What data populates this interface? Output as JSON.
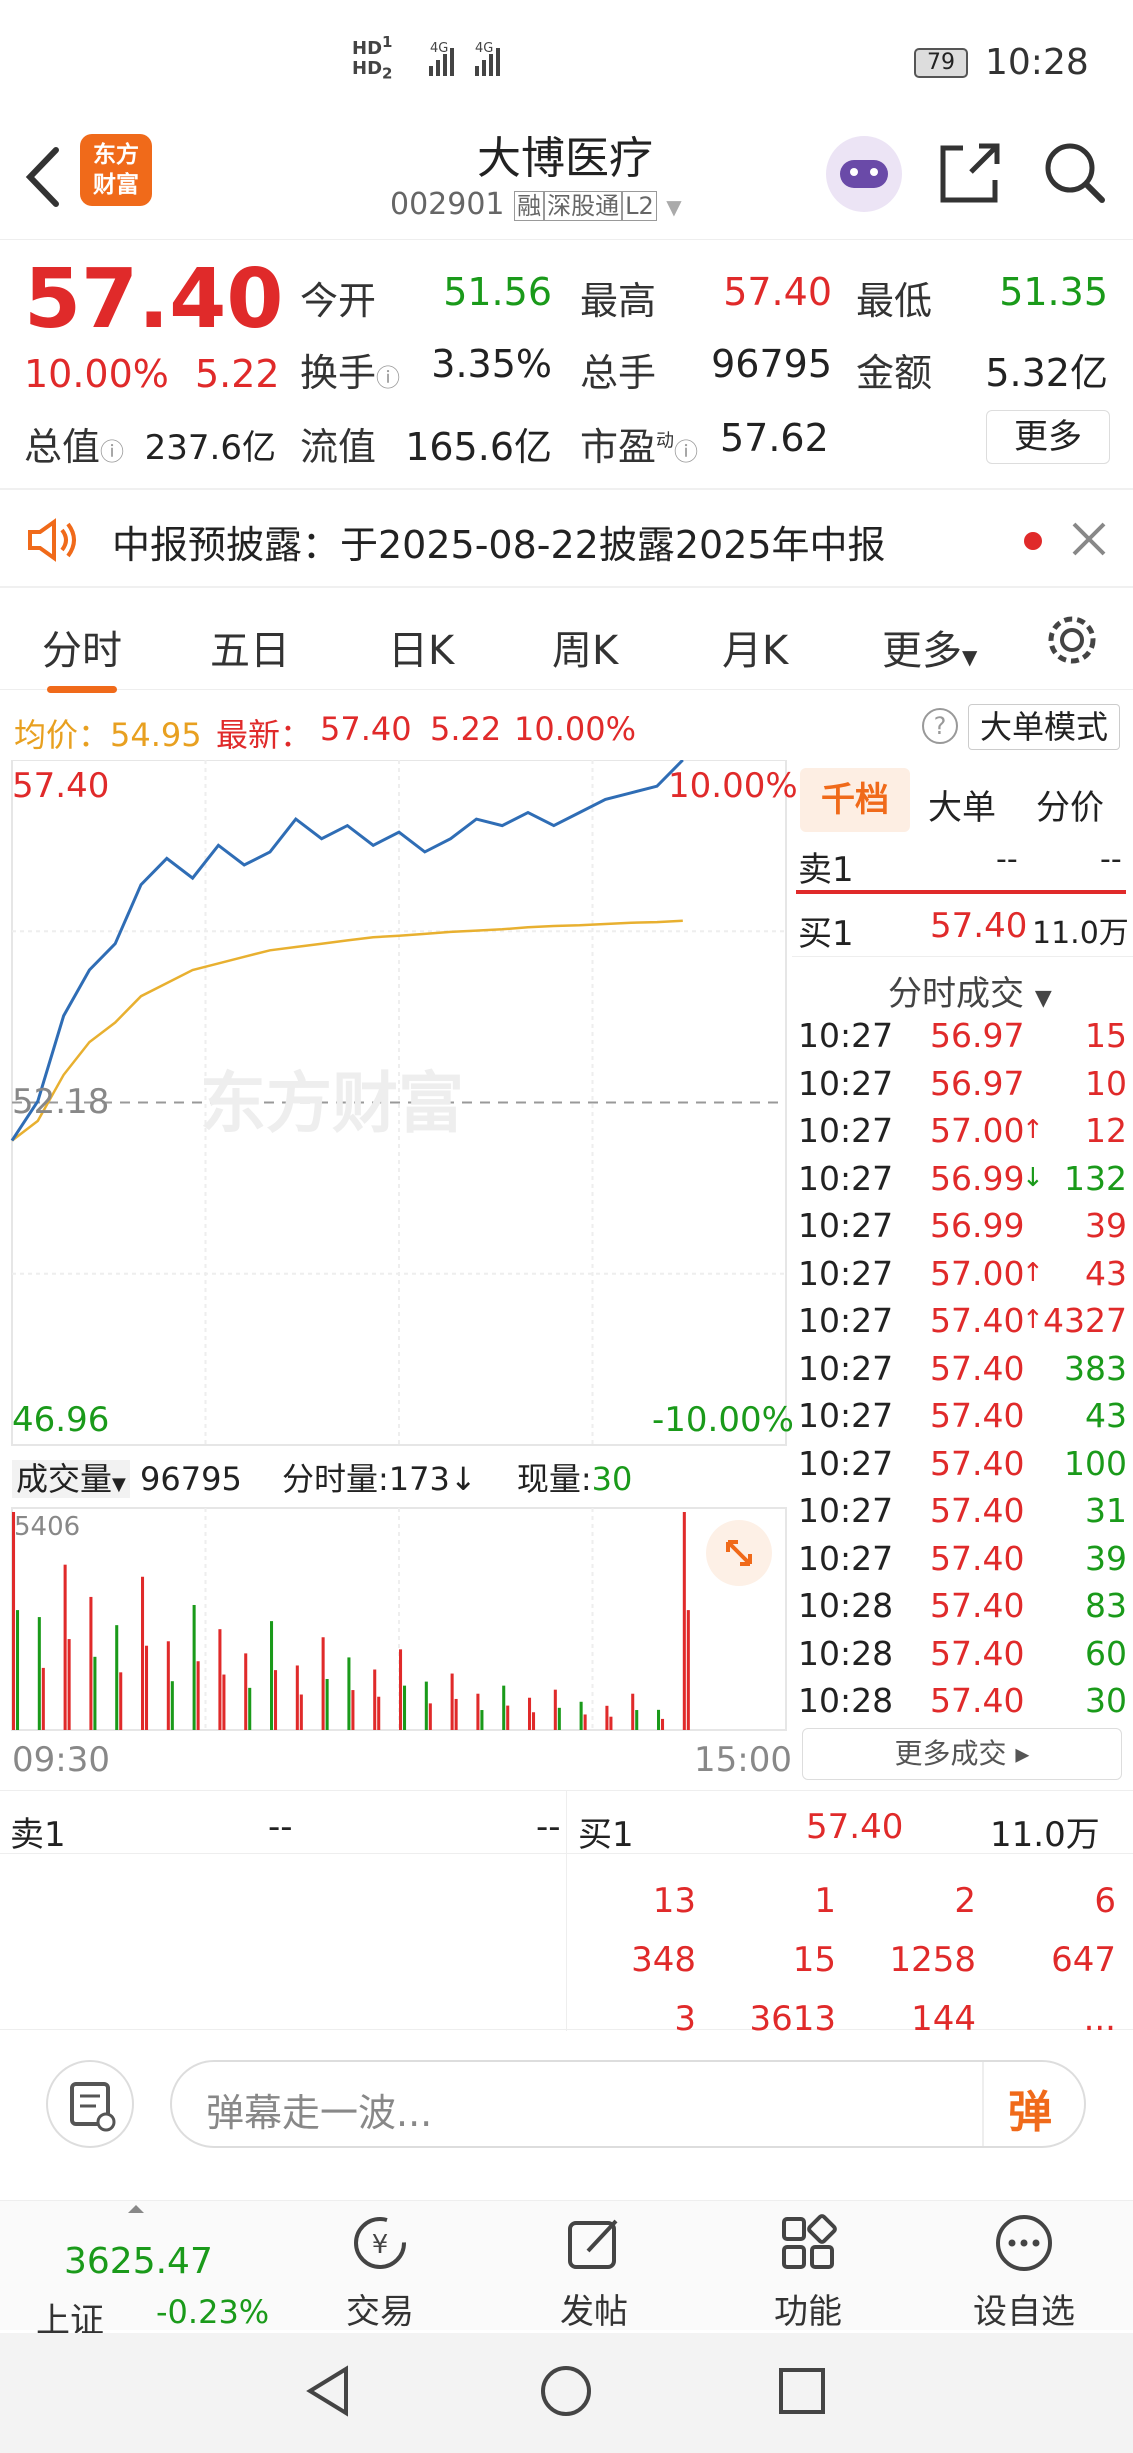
{
  "status_bar": {
    "sim": "HD1 HD2 4G 4G",
    "battery": "79",
    "time": "10:28"
  },
  "header": {
    "logo_line1": "东方",
    "logo_line2": "财富",
    "title": "大博医疗",
    "code": "002901",
    "tags": [
      "融",
      "深股通",
      "L2"
    ]
  },
  "quote": {
    "price": "57.40",
    "change_pct": "10.00%",
    "change_amt": "5.22",
    "fields": {
      "open_label": "今开",
      "open": "51.56",
      "high_label": "最高",
      "high": "57.40",
      "low_label": "最低",
      "low": "51.35",
      "turnover_label": "换手",
      "turnover": "3.35%",
      "volume_label": "总手",
      "volume": "96795",
      "amount_label": "金额",
      "amount": "5.32亿",
      "mktcap_label": "总值",
      "mktcap": "237.6亿",
      "float_label": "流值",
      "float_cap": "165.6亿",
      "pe_label": "市盈",
      "pe_sup": "动",
      "pe": "57.62"
    },
    "more_button": "更多"
  },
  "notice": {
    "text": "中报预披露：于2025-08-22披露2025年中报"
  },
  "tabs": [
    "分时",
    "五日",
    "日K",
    "周K",
    "月K",
    "更多"
  ],
  "info_bar": {
    "avg_label": "均价：",
    "avg": "54.95",
    "latest_label": "最新：",
    "latest": "57.40",
    "chg": "5.22",
    "pct": "10.00%",
    "mode_button": "大单模式"
  },
  "chart": {
    "y_top": "57.40",
    "y_top_pct": "10.00%",
    "y_mid": "52.18",
    "y_bot": "46.96",
    "y_bot_pct": "-10.00%",
    "watermark": "东方财富",
    "vol_label": "成交量",
    "vol_total": "96795",
    "vol_per_label": "分时量:",
    "vol_per": "173",
    "vol_now_label": "现量:",
    "vol_now": "30",
    "vol_max": "5406",
    "time_start": "09:30",
    "time_end": "15:00"
  },
  "chart_data": {
    "type": "line",
    "series": [
      {
        "values": [
          51.6,
          52.2,
          53.5,
          54.2,
          54.6,
          55.5,
          55.9,
          55.6,
          56.1,
          55.8,
          56.0,
          56.5,
          56.2,
          56.4,
          56.1,
          56.3,
          56.0,
          56.2,
          56.5,
          56.4,
          56.6,
          56.4,
          56.6,
          56.8,
          56.9,
          57.0,
          57.4
        ]
      },
      {
        "values": [
          51.6,
          51.9,
          52.6,
          53.1,
          53.4,
          53.8,
          54.0,
          54.2,
          54.3,
          54.4,
          54.5,
          54.55,
          54.6,
          54.65,
          54.7,
          54.72,
          54.75,
          54.78,
          54.8,
          54.82,
          54.85,
          54.87,
          54.88,
          54.9,
          54.92,
          54.93,
          54.95
        ]
      }
    ],
    "volumes": [
      5406,
      2800,
      4100,
      3300,
      2600,
      3800,
      2200,
      3100,
      2500,
      1900,
      2700,
      1600,
      2300,
      1800,
      1500,
      2000,
      1200,
      1400,
      900,
      1100,
      800,
      1000,
      700,
      600,
      900,
      500,
      5406
    ],
    "ylim": [
      46.96,
      57.4
    ],
    "xlabel": "",
    "ylabel": "",
    "x_ticks": [
      "09:30",
      "15:00"
    ]
  },
  "right_panel": {
    "tabs": [
      "千档",
      "大单",
      "分价"
    ],
    "sell1_label": "卖1",
    "sell1_price": "--",
    "sell1_vol": "--",
    "buy1_label": "买1",
    "buy1_price": "57.40",
    "buy1_vol": "11.0万",
    "ticks_header": "分时成交",
    "ticks": [
      {
        "t": "10:27",
        "p": "56.97",
        "a": "",
        "v": "15",
        "vc": "red"
      },
      {
        "t": "10:27",
        "p": "56.97",
        "a": "",
        "v": "10",
        "vc": "red"
      },
      {
        "t": "10:27",
        "p": "57.00",
        "a": "↑",
        "v": "12",
        "vc": "red"
      },
      {
        "t": "10:27",
        "p": "56.99",
        "a": "↓",
        "v": "132",
        "vc": "green"
      },
      {
        "t": "10:27",
        "p": "56.99",
        "a": "",
        "v": "39",
        "vc": "red"
      },
      {
        "t": "10:27",
        "p": "57.00",
        "a": "↑",
        "v": "43",
        "vc": "red"
      },
      {
        "t": "10:27",
        "p": "57.40",
        "a": "↑",
        "v": "4327",
        "vc": "red"
      },
      {
        "t": "10:27",
        "p": "57.40",
        "a": "",
        "v": "383",
        "vc": "green"
      },
      {
        "t": "10:27",
        "p": "57.40",
        "a": "",
        "v": "43",
        "vc": "green"
      },
      {
        "t": "10:27",
        "p": "57.40",
        "a": "",
        "v": "100",
        "vc": "green"
      },
      {
        "t": "10:27",
        "p": "57.40",
        "a": "",
        "v": "31",
        "vc": "green"
      },
      {
        "t": "10:27",
        "p": "57.40",
        "a": "",
        "v": "39",
        "vc": "green"
      },
      {
        "t": "10:28",
        "p": "57.40",
        "a": "",
        "v": "83",
        "vc": "green"
      },
      {
        "t": "10:28",
        "p": "57.40",
        "a": "",
        "v": "60",
        "vc": "green"
      },
      {
        "t": "10:28",
        "p": "57.40",
        "a": "",
        "v": "30",
        "vc": "green"
      }
    ],
    "more_ticks": "更多成交"
  },
  "order_book": {
    "sell1_label": "卖1",
    "sell1_price": "--",
    "sell1_vol": "--",
    "buy1_label": "买1",
    "buy1_price": "57.40",
    "buy1_vol": "11.0万",
    "queue": [
      [
        "13",
        "1",
        "2",
        "6"
      ],
      [
        "348",
        "15",
        "1258",
        "647"
      ],
      [
        "3",
        "3613",
        "144",
        "..."
      ]
    ]
  },
  "comment": {
    "placeholder": "弹幕走一波...",
    "send": "弹"
  },
  "bottom_nav": {
    "index_value": "3625.47",
    "index_name": "上证",
    "index_change": "-0.23%",
    "items": [
      "交易",
      "发帖",
      "功能",
      "设自选"
    ]
  },
  "colors": {
    "up": "#e02a2a",
    "down": "#1a9a1a",
    "accent": "#f06a1a",
    "avg_line": "#e8b030",
    "price_line": "#2f6db5"
  }
}
